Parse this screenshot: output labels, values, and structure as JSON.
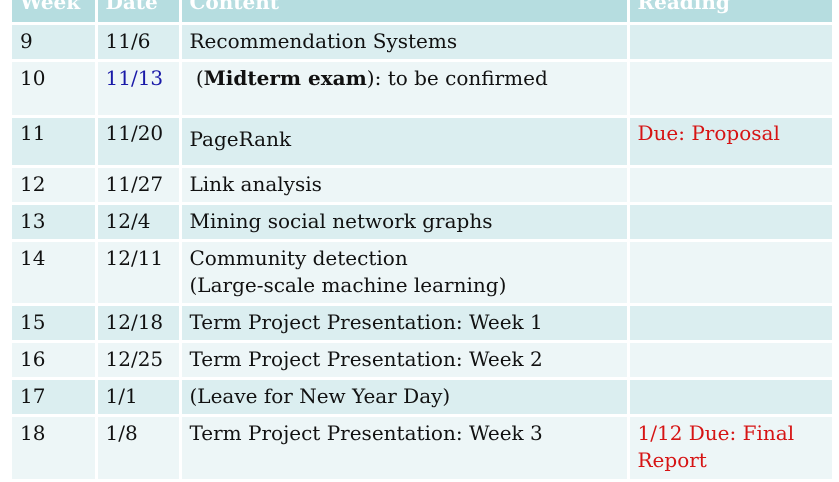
{
  "headers": [
    "Week",
    "Date",
    "Content",
    "Reading"
  ],
  "rows": [
    {
      "week": "9",
      "date": "11/6",
      "content": "Recommendation Systems",
      "reading": ""
    },
    {
      "week": "10",
      "date": "11/13",
      "content_pre": "(",
      "content_bold": "Midterm exam",
      "content_post": "): to be confirmed",
      "reading": ""
    },
    {
      "week": "11",
      "date": "11/20",
      "content": "PageRank",
      "reading": "Due: Proposal"
    },
    {
      "week": "12",
      "date": "11/27",
      "content": "Link analysis",
      "reading": ""
    },
    {
      "week": "13",
      "date": "12/4",
      "content": "Mining social network graphs",
      "reading": ""
    },
    {
      "week": "14",
      "date": "12/11",
      "content": "Community detection",
      "content_line2": "(Large-scale machine learning)",
      "reading": ""
    },
    {
      "week": "15",
      "date": "12/18",
      "content": "Term Project Presentation: Week 1",
      "reading": ""
    },
    {
      "week": "16",
      "date": "12/25",
      "content": "Term Project Presentation: Week 2",
      "reading": ""
    },
    {
      "week": "17",
      "date": "1/1",
      "content": "(Leave for New Year Day)",
      "reading": ""
    },
    {
      "week": "18",
      "date": "1/8",
      "content": "Term Project Presentation: Week 3",
      "reading": "1/12 Due: Final",
      "reading_line2": "Report"
    }
  ],
  "colors": {
    "header_bg": "#b6dde0",
    "row_dark": "#dbeef0",
    "row_light": "#edf6f7",
    "due_red": "#d61414",
    "date_blue": "#1a1aa8"
  }
}
